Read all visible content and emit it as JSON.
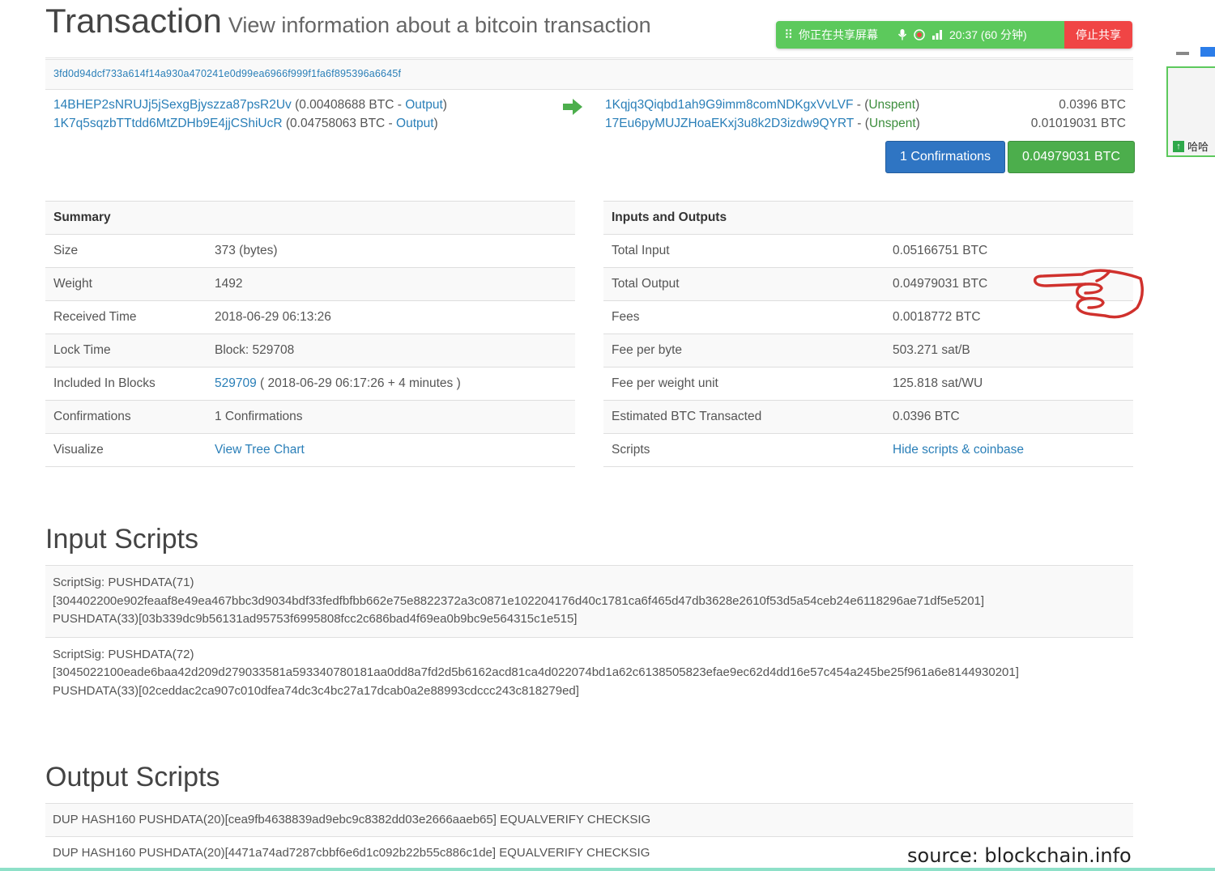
{
  "header": {
    "title": "Transaction",
    "subtitle": "View information about a bitcoin transaction"
  },
  "share_bar": {
    "status": "你正在共享屏幕",
    "time": "20:37 (60 分钟)",
    "stop_label": "停止共享",
    "color_left": "#5cc95c",
    "color_right": "#f04545"
  },
  "tx_hash": "3fd0d94dcf733a614f14a930a470241e0d99ea6966f999f1fa6f895396a6645f",
  "inputs": [
    {
      "address": "14BHEP2sNRUJj5jSexgBjyszza87psR2Uv",
      "amount": "(0.00408688 BTC - ",
      "link": "Output",
      "close": ")"
    },
    {
      "address": "1K7q5sqzbTTtdd6MtZDHb9E4jjCShiUcR",
      "amount": "(0.04758063 BTC - ",
      "link": "Output",
      "close": ")"
    }
  ],
  "outputs": [
    {
      "address": "1Kqjq3Qiqbd1ah9G9imm8comNDKgxVvLVF",
      "sep": " - (",
      "status": "Unspent",
      "close": ")",
      "value": "0.0396 BTC"
    },
    {
      "address": "17Eu6pyMUJZHoaEKxj3u8k2D3izdw9QYRT",
      "sep": " - (",
      "status": "Unspent",
      "close": ")",
      "value": "0.01019031 BTC"
    }
  ],
  "buttons": {
    "confirmations": "1 Confirmations",
    "total": "0.04979031 BTC"
  },
  "summary": {
    "heading": "Summary",
    "rows": [
      {
        "label": "Size",
        "value": "373 (bytes)"
      },
      {
        "label": "Weight",
        "value": "1492"
      },
      {
        "label": "Received Time",
        "value": "2018-06-29 06:13:26"
      },
      {
        "label": "Lock Time",
        "value": "Block: 529708"
      },
      {
        "label": "Included In Blocks",
        "link": "529709",
        "value": " ( 2018-06-29 06:17:26 + 4 minutes )"
      },
      {
        "label": "Confirmations",
        "value": "1 Confirmations"
      },
      {
        "label": "Visualize",
        "link": "View Tree Chart"
      }
    ]
  },
  "io": {
    "heading": "Inputs and Outputs",
    "rows": [
      {
        "label": "Total Input",
        "value": "0.05166751 BTC"
      },
      {
        "label": "Total Output",
        "value": "0.04979031 BTC"
      },
      {
        "label": "Fees",
        "value": "0.0018772 BTC"
      },
      {
        "label": "Fee per byte",
        "value": "503.271 sat/B"
      },
      {
        "label": "Fee per weight unit",
        "value": "125.818 sat/WU"
      },
      {
        "label": "Estimated BTC Transacted",
        "value": "0.0396 BTC"
      },
      {
        "label": "Scripts",
        "link": "Hide scripts & coinbase"
      }
    ]
  },
  "input_scripts": {
    "title": "Input Scripts",
    "blocks": [
      [
        "ScriptSig: PUSHDATA(71)",
        "[304402200e902feaaf8e49ea467bbc3d9034bdf33fedfbfbb662e75e8822372a3c0871e102204176d40c1781ca6f465d47db3628e2610f53d5a54ceb24e6118296ae71df5e5201]",
        "PUSHDATA(33)[03b339dc9b56131ad95753f6995808fcc2c686bad4f69ea0b9bc9e564315c1e515]"
      ],
      [
        "ScriptSig: PUSHDATA(72)",
        "[3045022100eade6baa42d209d279033581a593340780181aa0dd8a7fd2d5b6162acd81ca4d022074bd1a62c6138505823efae9ec62d4dd16e57c454a245be25f961a6e8144930201]",
        "PUSHDATA(33)[02ceddac2ca907c010dfea74dc3c4bc27a17dcab0a2e88993cdccc243c818279ed]"
      ]
    ]
  },
  "output_scripts": {
    "title": "Output Scripts",
    "rows": [
      "DUP HASH160 PUSHDATA(20)[cea9fb4638839ad9ebc9c8382dd03e2666aaeb65] EQUALVERIFY CHECKSIG",
      "DUP HASH160 PUSHDATA(20)[4471a74ad7287cbbf6e6d1c092b22b55c886c1de] EQUALVERIFY CHECKSIG"
    ]
  },
  "source_caption": "source: blockchain.info",
  "side_widget": {
    "button_label": "哈哈"
  }
}
